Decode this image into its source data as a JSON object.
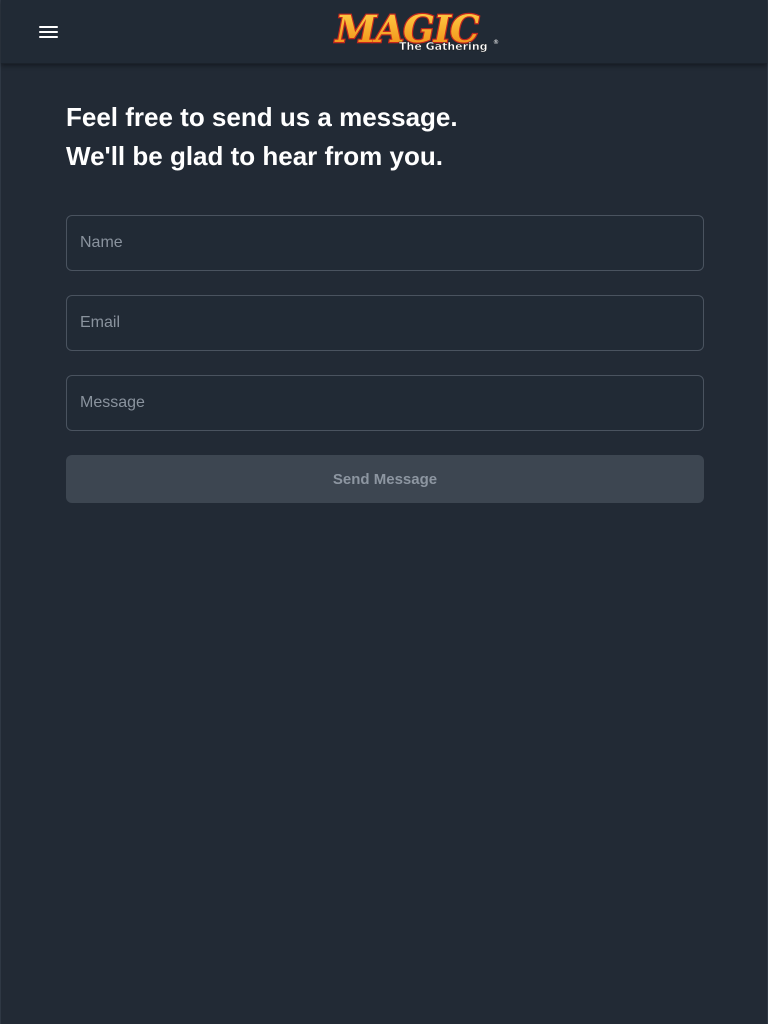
{
  "header": {
    "menu_icon": "hamburger-menu-icon",
    "logo": {
      "word": "MAGIC",
      "subtitle": "The Gathering",
      "registered": "®",
      "fill_color": "#f7b21c",
      "outline_color": "#c4271e"
    }
  },
  "contact": {
    "heading_line1": "Feel free to send us a message.",
    "heading_line2": "We'll be glad to hear from you.",
    "name_placeholder": "Name",
    "name_value": "",
    "email_placeholder": "Email",
    "email_value": "",
    "message_placeholder": "Message",
    "message_value": "",
    "send_label": "Send Message"
  },
  "colors": {
    "background": "#222a35",
    "header": "#212a35",
    "field_border": "#4a535f",
    "button_bg": "#3d4651",
    "button_text": "#8d96a1",
    "heading_text": "#ffffff"
  }
}
